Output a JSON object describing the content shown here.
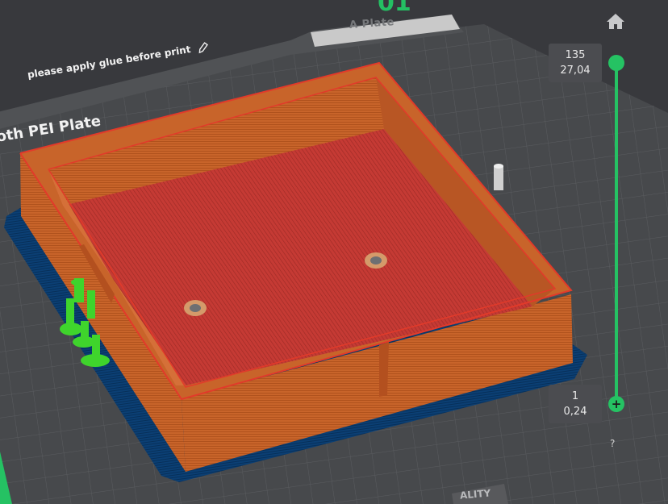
{
  "header": {
    "top_number": "01"
  },
  "build_plate": {
    "tab_label": "A Plate",
    "note": "please apply glue before print",
    "plate_name": "oth PEI Plate",
    "bottom_tab": "ALITY"
  },
  "layer_slider": {
    "top_layer": "135",
    "top_height": "27,04",
    "bottom_layer": "1",
    "bottom_height": "0,24",
    "add_symbol": "+",
    "help_symbol": "?"
  },
  "icons": [
    "home-icon",
    "edit-pencil-icon"
  ],
  "colors": {
    "accent": "#25c263",
    "model_wall": "#c8642a",
    "model_floor": "#c53a34",
    "brim": "#0a3e72",
    "support": "#3fd42c",
    "background": "#38393d"
  }
}
